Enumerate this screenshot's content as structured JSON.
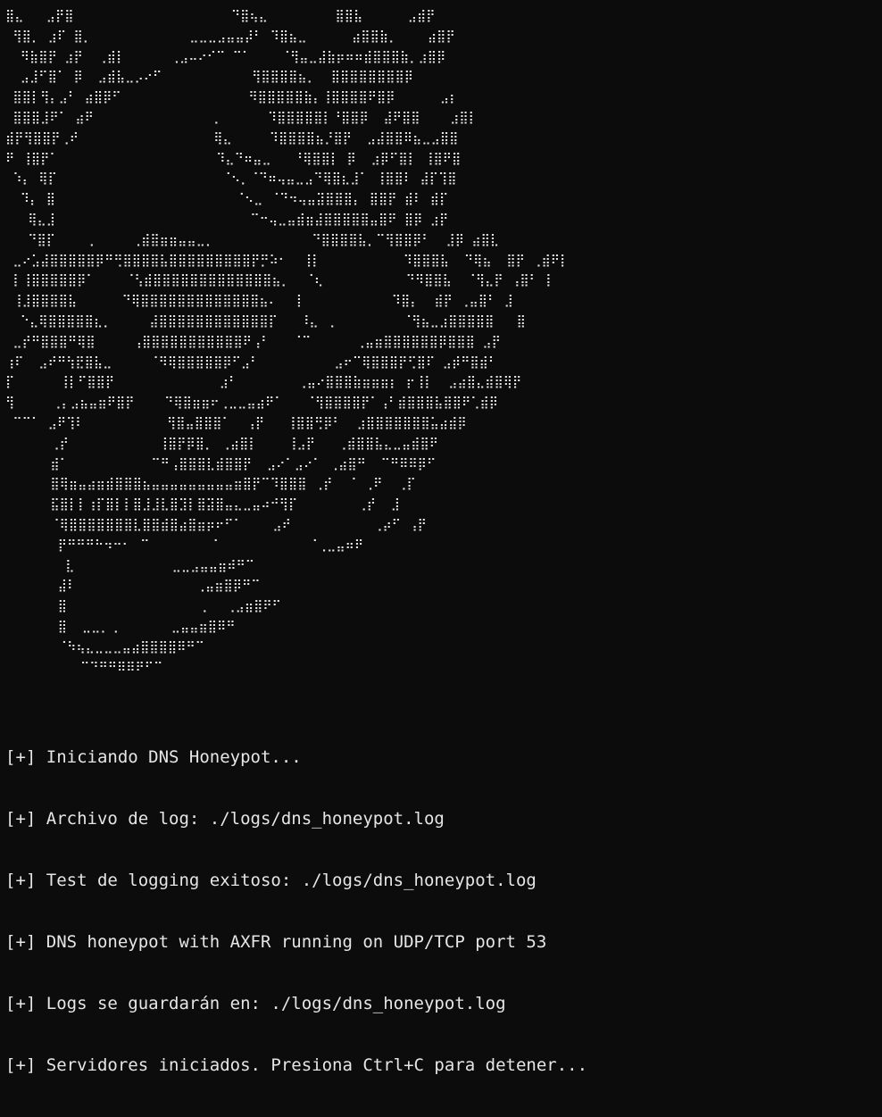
{
  "terminal": {
    "background": "#0c0c0c",
    "foreground": "#e6e6e6"
  },
  "banner": {
    "ascii_art": "⣿⣄   ⣠⡟⣿                     ⠙⣿⢦⣄         ⣿⣿⣧      ⣠⣾⡟\n ⢻⣿⡀ ⣰⠏ ⣿⡀             ⣀⣀⣀⣠⣤⣤⡼⠃ ⠹⣿⣦⣀      ⣴⣿⣿⣷⡀    ⣴⣿⡟\n  ⠻⣷⣿⡟ ⣰⡟  ⢀⣾⡇      ⢀⣠⠤⠔⠊⠉ ⠉⠁    ⠈⢻⣤⣀⣼⣷⡶⠶⠶⣾⣿⣿⣿⣷⡀⣰⣿⡿\n  ⣠⣸⠋⣿⠁ ⡿  ⣠⣾⣧⣀⡠⠔⠋            ⢻⣿⣿⣿⣿⣦⡀  ⣿⣿⣿⣿⣿⣿⣿⣿⡿\n ⣿⣿⡇⢻⡄⣠⠃ ⣴⣿⡿⠋                 ⠻⣿⣿⣿⣿⣿⣷⡄⢸⣿⣿⣿⣿⠟⣿⡿      ⣠⡆\n ⣿⣿⣿⣸⠟⠁ ⣴⠟                ⡀      ⠹⣿⣿⣿⣿⣿⡇⠘⣿⣿⡿  ⣼⠟⣿⣿    ⣰⣿⡇\n⣾⡟⢻⣿⣿⡟⢀⠞                  ⢿⣄     ⠹⣿⣿⣿⣿⣦⡘⣿⡟  ⣠⣼⣿⣿⠿⣦⣀⣠⣿⣿\n⠟ ⢸⣿⡟⠁                     ⠹⣄⠙⠶⣤⣀   ⠘⢿⣿⣿⡇ ⡿  ⣰⡿⠋⣿⡇ ⢸⣿⠟⣿\n ⠱⡄ ⢿⡏                      ⠈⠢⡀⠈⠙⠶⢤⣤⣀⣠⠙⢿⣿⣆⣸⠁ ⢸⣿⣿⠇ ⣼⡏⢹⣿\n  ⠹⡄ ⣿                        ⠈⠢⣀ ⠈⠙⠲⢤⣤⣽⣿⣿⣿⡄ ⣿⣿⡟ ⣾⠇ ⣾⡏\n   ⢿⣄⣸                          ⠉⠒⢤⣀⣤⣾⣶⣼⣿⣿⣿⣿⣿⣤⣿⠟ ⣿⡿ ⣰⡟\n   ⠙⣿⡏    ⢀     ⢀⣾⣿⣶⣶⣤⣤⣀⡀             ⠙⣿⣿⣿⣿⣧⡀⠉⢻⣿⣿⡿⠃  ⣸⡿ ⣴⣿⣇\n ⣀⠔⣡⣼⣿⣿⣿⣿⣿⡿⠛⢛⣿⣿⣿⣿⣧⣿⣿⣿⣿⣿⣿⣿⣿⣿⡟⡛⠵⠂  ⢸⡇           ⠹⣿⣿⣿⣧  ⠙⢿⣦  ⣿⡟ ⢀⣾⠟⡇\n ⡇⢸⣿⣿⣿⣿⣿⡿⠁    ⠈⢣⣾⣿⣿⣿⣿⣿⣿⣿⣿⣿⣿⣿⣿⣿⣦⡀  ⠈⢆           ⠙⠻⣿⣿⣧  ⠈⢻⣄⡟ ⢠⣿⠃ ⡇\n ⢸⣸⣿⣿⣿⣿⣧      ⠙⢿⣿⣿⣿⣿⣿⣿⣿⣿⣿⣿⣿⣿⣿⣦⠄  ⢸            ⠹⣿⡄  ⣾⡟ ⢀⣤⣿⠃ ⣸\n  ⠑⣄⢿⣿⣿⣿⣿⣿⣆⡀     ⣼⣿⣿⣿⣿⣿⣿⣿⣿⣿⣿⣿⣿⡏   ⠸⣄ ⢀         ⠈⢻⣦⣀⣰⣿⣿⣿⣿⣿   ⣿\n ⣀⡞⠛⣿⣿⣿⠛⢿⣿     ⢠⣿⣿⣿⣿⣿⣿⣿⣿⣿⣿⣿⠟⢠⠃   ⠈⠉      ⢀⣤⣶⣿⣿⣿⣿⣿⣿⡿⣿⣿⣿ ⣠⡟\n⢰⠏  ⣠⠞⠛⢳⣟⣿⣧⣀     ⠈⠻⢿⣿⣿⣿⣿⣿⡿⠋⣠⠃          ⣠⠖⠉⢿⣿⣿⣿⡟⢋⣿⠏ ⣠⡾⠛⣿⣾⠃\n⡏      ⢸⡇⠋⣿⣿⡟              ⣰⠃        ⢀⣤⠔⣿⣿⣿⣷⣶⣶⣶⡆ ⡖⢸⡇  ⣠⣴⣿⣄⣾⣿⢿⡟\n⢻     ⢀⡄⣠⣦⣤⣶⠟⣿⡟    ⠙⢿⣿⣶⣶⠖⢀⣀⣀⣤⣴⠟⠁   ⠈⢻⣿⣿⣿⣿⡟⠁⢠⠃⣾⣿⣿⣿⣧⣿⣿⠟⢁⣾⡿\n ⠉⠉⠁ ⣠⠟⢹⠇           ⢻⣿⣤⣿⣿⣿⠁  ⢠⡟   ⢸⣿⣿⢛⡿⠃  ⣰⣿⣿⣿⣿⣿⣿⣿⣥⣴⣾⡿\n      ⢀⡞            ⢸⣿⡟⡿⣿⡀ ⢀⣴⣿⡇    ⢸⣠⡟   ⢀⣾⣿⣿⣧⣄⣀⣤⣾⣿⠟\n      ⣾⠁           ⠉⠛⢠⣿⣿⣿⣇⣾⣿⣿⡟  ⣠⠔⠁⣠⠔⠁ ⢀⣴⣿⠛  ⠉⠛⠿⠿⡿⠋\n      ⣿⢿⣶⣤⣴⣶⣾⣿⣿⣿⣦⣤⣤⣤⣤⣤⣤⣤⣤⣤⣶⣿⡟⠉⠹⣿⣿⣿ ⢀⡞  ⠈ ⢀⠟  ⢀⡏\n      ⣯⣿⡇⡇⢰⡏⣿⡇⡇⣿⣸⣸⣇⣿⣹⡇⣿⣽⣿⣤⣄⣀⣤⠴⠚⢻⡏        ⢀⡞  ⣸\n      ⠈⢿⣿⣿⣿⣿⣿⣿⣿⣇⣿⣿⣾⣿⣴⣿⣶⡶⠖⠋⠁    ⣠⠞           ⢀⡴⠋ ⢠⡟\n       ⡟⠛⠛⠛⠓⠲⠒⠂⠀⠉        ⠈            ⠈⢀⣀⣤⠶⠟\n        ⣇             ⣀⣀⣠⣤⣤⣶⠾⠛⠉\n       ⣼⠇                ⢀⣤⣶⣿⡿⠛⠉\n       ⣿                  ⡀  ⢀⣠⣶⣿⠟⠋\n       ⣿  ⣀⣀⡀⢀       ⣀⣤⣤⣶⣿⠿⠛\n       ⠈⠳⢦⣄⣀⣀⣀⣤⣴⣿⣿⣿⣿⠿⠛⠉\n          ⠉⠙⠛⠛⠿⠿⠟⠋⠉"
  },
  "log": [
    "[+] Iniciando DNS Honeypot...",
    "[+] Archivo de log: ./logs/dns_honeypot.log",
    "[+] Test de logging exitoso: ./logs/dns_honeypot.log",
    "[+] DNS honeypot with AXFR running on UDP/TCP port 53",
    "[+] Logs se guardarán en: ./logs/dns_honeypot.log",
    "[+] Servidores iniciados. Presiona Ctrl+C para detener..."
  ]
}
